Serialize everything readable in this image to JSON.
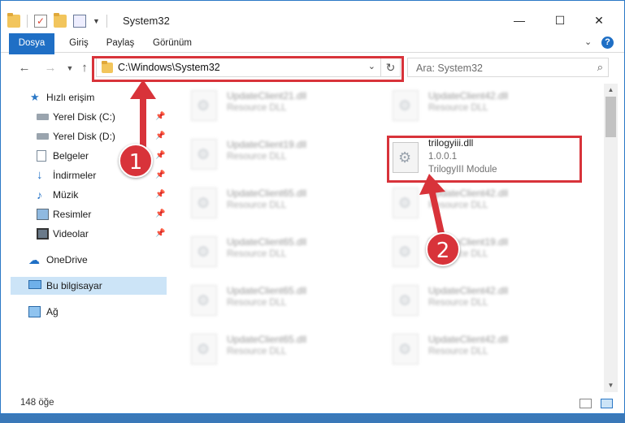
{
  "window": {
    "title": "System32"
  },
  "ribbon": {
    "tabs": [
      "Dosya",
      "Giriş",
      "Paylaş",
      "Görünüm"
    ]
  },
  "address": {
    "path": "C:\\Windows\\System32"
  },
  "search": {
    "placeholder": "Ara: System32"
  },
  "sidebar": {
    "items": [
      {
        "label": "Hızlı erişim",
        "icon": "star-icon",
        "pinned": false
      },
      {
        "label": "Yerel Disk (C:)",
        "icon": "drive-icon",
        "pinned": true
      },
      {
        "label": "Yerel Disk (D:)",
        "icon": "drive-icon",
        "pinned": true
      },
      {
        "label": "Belgeler",
        "icon": "documents-icon",
        "pinned": true
      },
      {
        "label": "İndirmeler",
        "icon": "download-icon",
        "pinned": true
      },
      {
        "label": "Müzik",
        "icon": "music-icon",
        "pinned": true
      },
      {
        "label": "Resimler",
        "icon": "pictures-icon",
        "pinned": true
      },
      {
        "label": "Videolar",
        "icon": "videos-icon",
        "pinned": true
      },
      {
        "label": "OneDrive",
        "icon": "cloud-icon",
        "pinned": false
      },
      {
        "label": "Bu bilgisayar",
        "icon": "computer-icon",
        "pinned": false,
        "selected": true
      },
      {
        "label": "Ağ",
        "icon": "network-icon",
        "pinned": false
      }
    ]
  },
  "files": [
    {
      "name": "UpdateClient21.dll",
      "type": "Resource DLL"
    },
    {
      "name": "UpdateClient42.dll",
      "type": "Resource DLL"
    },
    {
      "name": "UpdateClient19.dll",
      "type": "Resource DLL"
    },
    {
      "name": "trilogyiii.dll",
      "version": "1.0.0.1",
      "type": "TrilogyIII Module",
      "highlighted": true
    },
    {
      "name": "UpdateClient65.dll",
      "type": "Resource DLL"
    },
    {
      "name": "UpdateClient42.dll",
      "type": "Resource DLL"
    },
    {
      "name": "UpdateClient65.dll",
      "type": "Resource DLL"
    },
    {
      "name": "UpdateClient19.dll",
      "type": "Resource DLL"
    },
    {
      "name": "UpdateClient65.dll",
      "type": "Resource DLL"
    },
    {
      "name": "UpdateClient42.dll",
      "type": "Resource DLL"
    },
    {
      "name": "UpdateClient65.dll",
      "type": "Resource DLL"
    },
    {
      "name": "UpdateClient42.dll",
      "type": "Resource DLL"
    }
  ],
  "status": {
    "item_count": "148 öğe"
  },
  "annotations": {
    "step1": "1",
    "step2": "2",
    "color": "#d8333a"
  }
}
